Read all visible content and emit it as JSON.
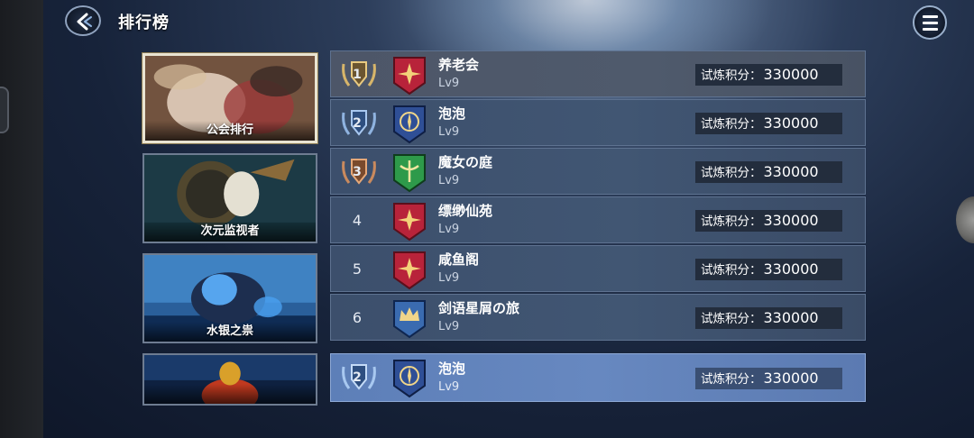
{
  "header": {
    "title": "排行榜"
  },
  "categories": [
    {
      "label": "公会排行",
      "active": true
    },
    {
      "label": "次元监视者",
      "active": false
    },
    {
      "label": "水银之祟",
      "active": false
    },
    {
      "label": "",
      "active": false
    }
  ],
  "ranking": {
    "score_label": "试炼积分：",
    "rows": [
      {
        "rank": "1",
        "medal": "gold",
        "emblem": "red-star-emblem",
        "name": "养老会",
        "level": "Lv9",
        "score": "330000"
      },
      {
        "rank": "2",
        "medal": "silver",
        "emblem": "blue-compass-emblem",
        "name": "泡泡",
        "level": "Lv9",
        "score": "330000"
      },
      {
        "rank": "3",
        "medal": "bronze",
        "emblem": "green-wing-emblem",
        "name": "魔女の庭",
        "level": "Lv9",
        "score": "330000"
      },
      {
        "rank": "4",
        "medal": "",
        "emblem": "red-star-emblem",
        "name": "缥缈仙苑",
        "level": "Lv9",
        "score": "330000"
      },
      {
        "rank": "5",
        "medal": "",
        "emblem": "red-star-emblem",
        "name": "咸鱼阁",
        "level": "Lv9",
        "score": "330000"
      },
      {
        "rank": "6",
        "medal": "",
        "emblem": "blue-crown-emblem",
        "name": "剑语星屑の旅",
        "level": "Lv9",
        "score": "330000"
      }
    ]
  },
  "my_guild": {
    "rank": "2",
    "medal": "silver",
    "emblem": "blue-compass-emblem",
    "name": "泡泡",
    "level": "Lv9",
    "score": "330000",
    "score_label": "试炼积分："
  },
  "colors": {
    "gold": "#d7b56a",
    "silver": "#8fb3e0",
    "bronze": "#c98a5e",
    "red": "#c3263a",
    "blue": "#3a5fa8",
    "green": "#2e9a4a"
  }
}
